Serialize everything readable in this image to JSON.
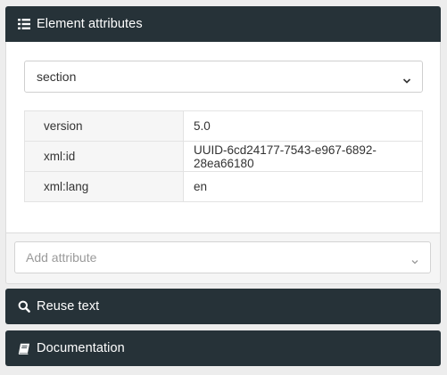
{
  "panels": {
    "attributes": {
      "title": "Element attributes",
      "icon": "list-icon",
      "element_select": {
        "selected": "section"
      },
      "rows": [
        {
          "key": "version",
          "value": "5.0"
        },
        {
          "key": "xml:id",
          "value": "UUID-6cd24177-7543-e967-6892-28ea66180"
        },
        {
          "key": "xml:lang",
          "value": "en"
        }
      ],
      "add_attribute": {
        "placeholder": "Add attribute"
      }
    },
    "reuse": {
      "title": "Reuse text",
      "icon": "search-icon"
    },
    "documentation": {
      "title": "Documentation",
      "icon": "book-icon"
    }
  },
  "colors": {
    "header_bg": "#263238",
    "header_text": "#ffffff",
    "page_bg": "#ededed",
    "key_cell_bg": "#f6f6f6",
    "placeholder_text": "#9a9a9a"
  }
}
